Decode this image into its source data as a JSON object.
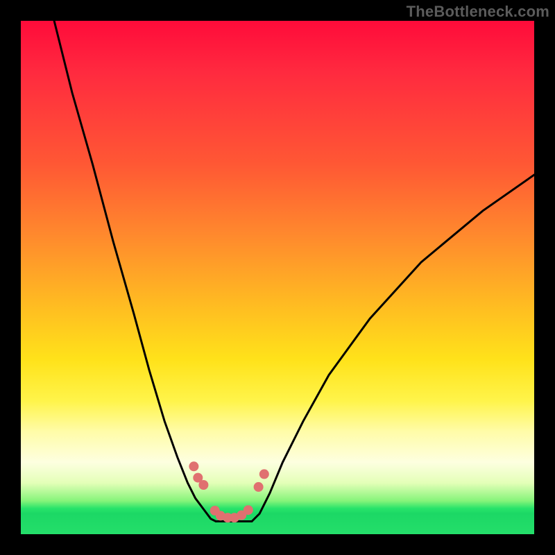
{
  "watermark": "TheBottleneck.com",
  "chart_data": {
    "type": "line",
    "title": "",
    "xlabel": "",
    "ylabel": "",
    "xlim": [
      0,
      100
    ],
    "ylim": [
      0,
      100
    ],
    "grid": false,
    "legend": false,
    "annotations": [],
    "series": [
      {
        "name": "left-curve",
        "x": [
          6.5,
          10,
          14,
          18,
          22,
          25,
          28,
          30.5,
          32.5,
          34,
          35.5,
          37,
          38
        ],
        "values": [
          100,
          86,
          72,
          57,
          43,
          32,
          22,
          15,
          10,
          7,
          5,
          3,
          2.5
        ]
      },
      {
        "name": "right-curve",
        "x": [
          45,
          46.5,
          48.5,
          51,
          55,
          60,
          68,
          78,
          90,
          100
        ],
        "values": [
          2.5,
          4,
          8,
          14,
          22,
          31,
          42,
          53,
          63,
          70
        ]
      },
      {
        "name": "valley-floor",
        "x": [
          38,
          40,
          42,
          44,
          45
        ],
        "values": [
          2.5,
          2.5,
          2.5,
          2.5,
          2.5
        ]
      }
    ],
    "markers": {
      "name": "beads",
      "points": [
        {
          "x": 33.7,
          "y": 13.2
        },
        {
          "x": 34.5,
          "y": 11.0
        },
        {
          "x": 35.6,
          "y": 9.6
        },
        {
          "x": 37.8,
          "y": 4.6
        },
        {
          "x": 38.9,
          "y": 3.6
        },
        {
          "x": 40.3,
          "y": 3.2
        },
        {
          "x": 41.6,
          "y": 3.2
        },
        {
          "x": 43.0,
          "y": 3.7
        },
        {
          "x": 44.3,
          "y": 4.7
        },
        {
          "x": 46.3,
          "y": 9.2
        },
        {
          "x": 47.4,
          "y": 11.7
        }
      ]
    },
    "background_gradient": {
      "orientation": "vertical",
      "stops": [
        {
          "pos": 0.0,
          "color": "#ff0b3a"
        },
        {
          "pos": 0.42,
          "color": "#ff8a2d"
        },
        {
          "pos": 0.66,
          "color": "#ffe21a"
        },
        {
          "pos": 0.86,
          "color": "#fdffe0"
        },
        {
          "pos": 0.95,
          "color": "#27e36a"
        },
        {
          "pos": 1.0,
          "color": "#24de6a"
        }
      ]
    }
  }
}
